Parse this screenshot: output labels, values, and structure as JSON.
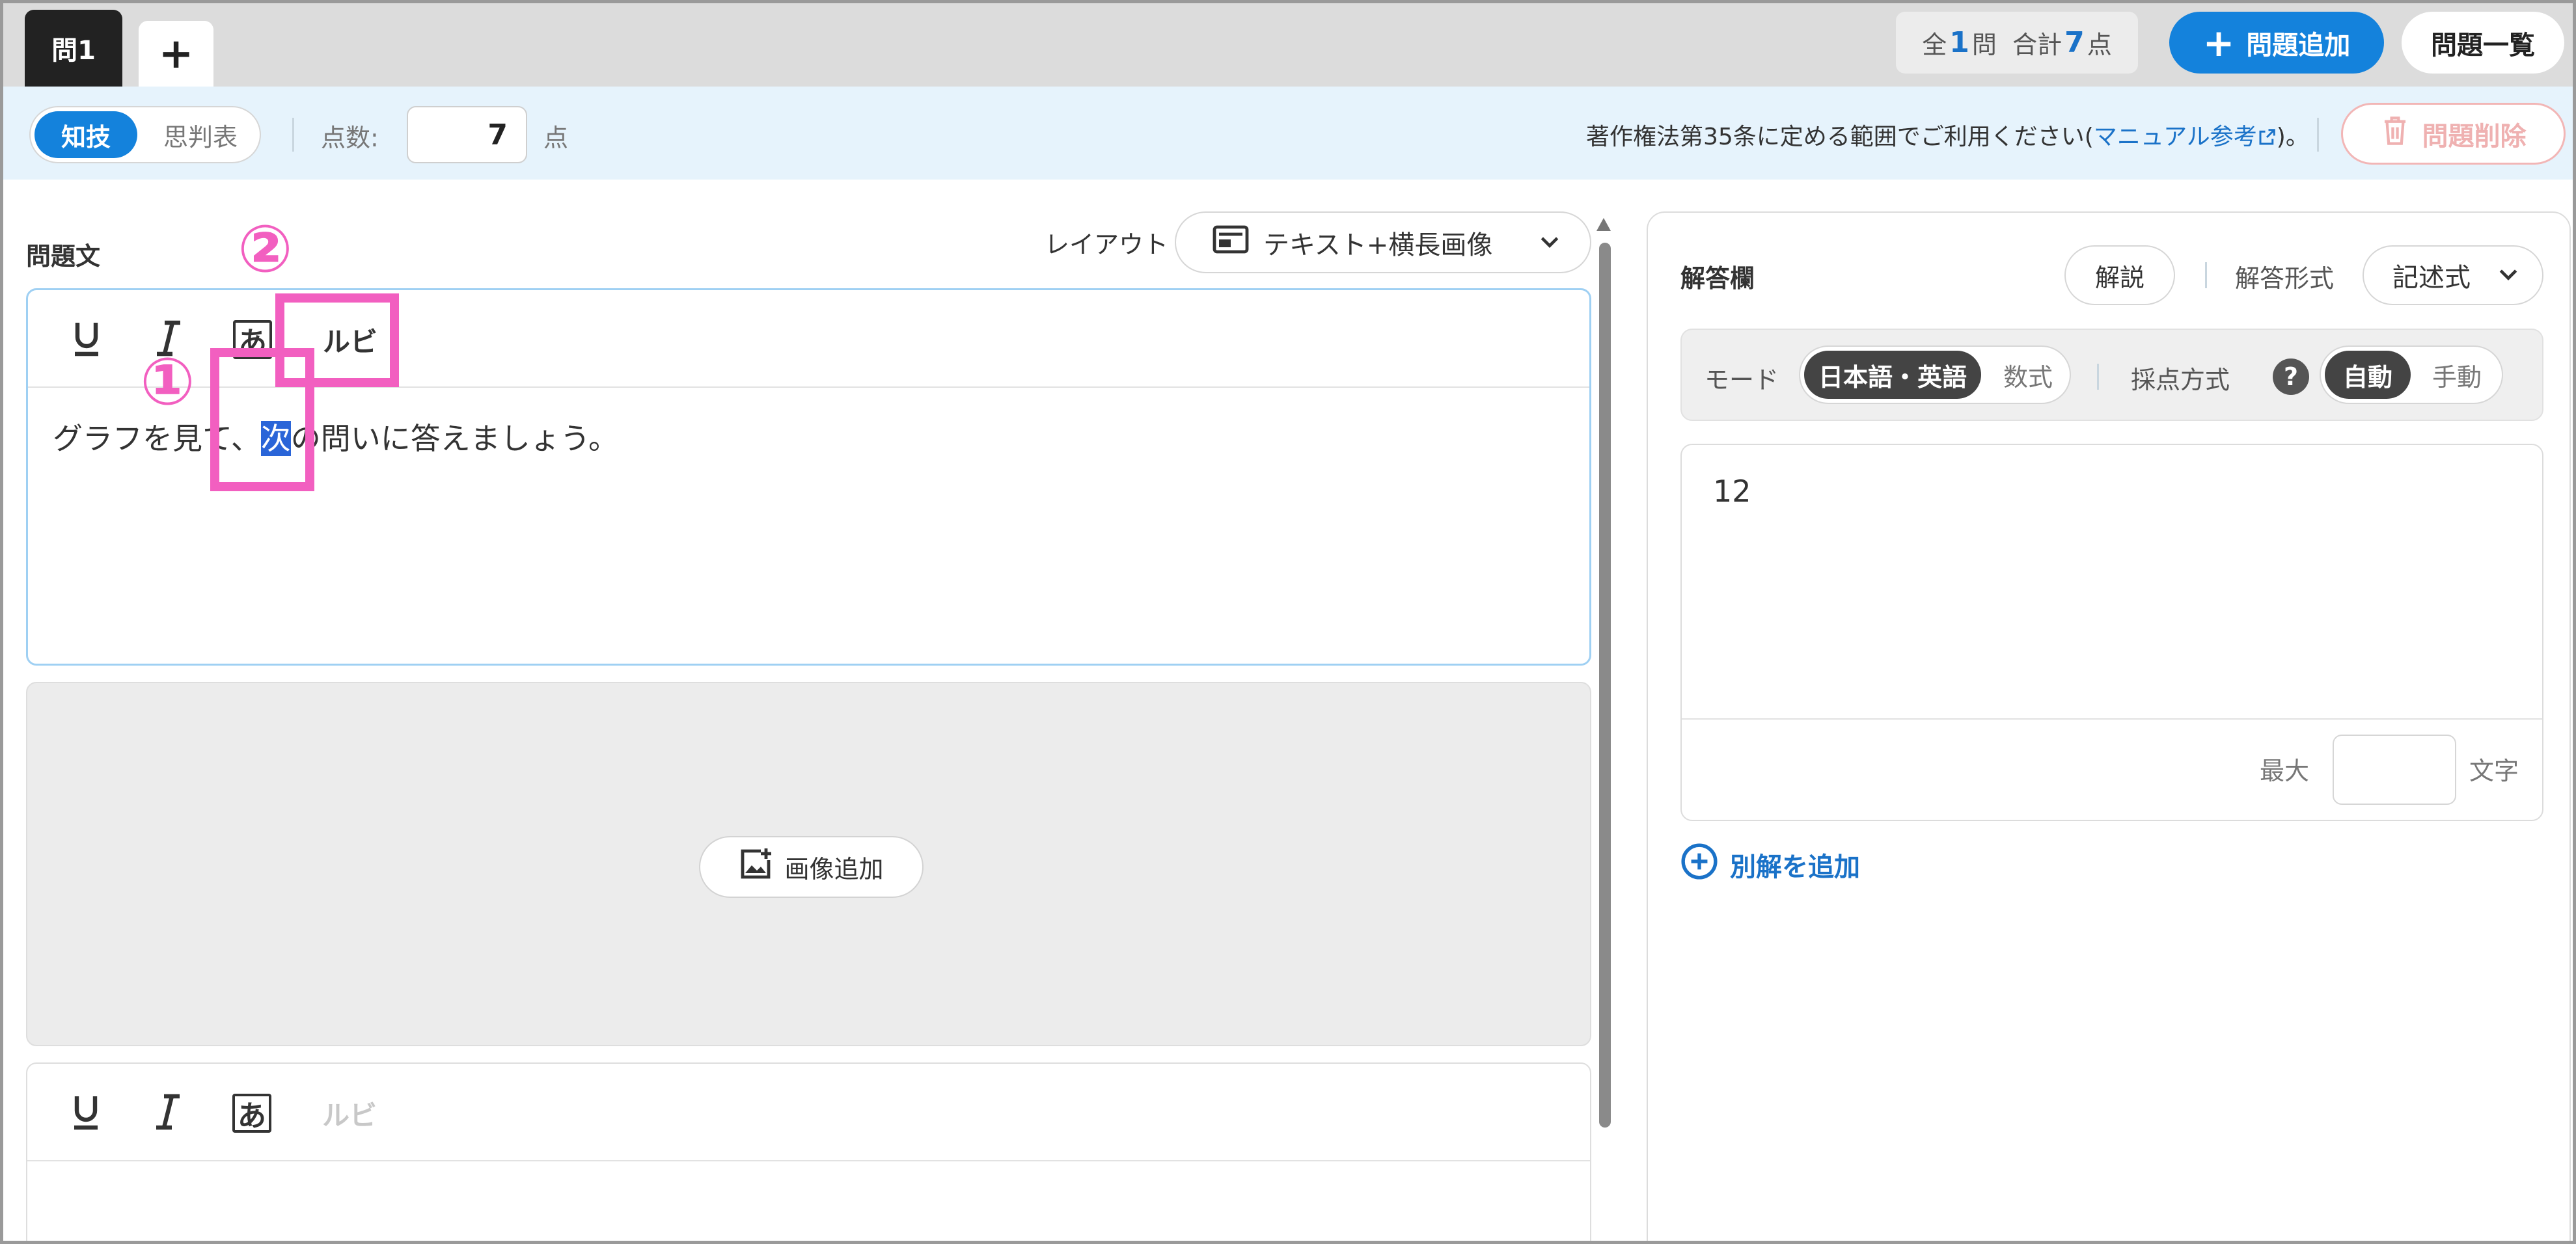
{
  "tabs": {
    "active_label": "問1",
    "add_label": "+"
  },
  "summary": {
    "prefix": "全",
    "count": "1",
    "count_unit": "問",
    "total_label": "合計",
    "total": "7",
    "total_unit": "点"
  },
  "header_buttons": {
    "add_question": "問題追加",
    "question_list": "問題一覧"
  },
  "settings": {
    "category_selected": "知技",
    "category_other": "思判表",
    "score_label": "点数:",
    "score_value": "7",
    "score_unit": "点",
    "copyright_text": "著作権法第35条に定める範囲でご利用ください(",
    "copyright_link": "マニュアル参考",
    "copyright_end": ")。",
    "delete_label": "問題削除"
  },
  "question": {
    "label": "問題文",
    "layout_label": "レイアウト",
    "layout_value": "テキスト+横長画像",
    "toolbar": {
      "underline": "U",
      "italic": "I",
      "kana": "あ",
      "ruby": "ルビ"
    },
    "text_before": "グラフを見て、",
    "text_selected": "次",
    "text_after": "の問いに答えましょう。",
    "image_add_label": "画像追加"
  },
  "annotations": {
    "one": "①",
    "two": "②"
  },
  "answer": {
    "label": "解答欄",
    "explain_label": "解説",
    "format_label": "解答形式",
    "format_value": "記述式",
    "mode_label": "モード",
    "mode_selected": "日本語・英語",
    "mode_other": "数式",
    "scoring_label": "採点方式",
    "scoring_help": "?",
    "scoring_selected": "自動",
    "scoring_other": "手動",
    "value": "12",
    "max_label": "最大",
    "chars_label": "文字",
    "add_alt_label": "別解を追加"
  },
  "colors": {
    "accent": "#1482dc",
    "annotation": "#f25fc0",
    "selection": "#2a65d8"
  }
}
